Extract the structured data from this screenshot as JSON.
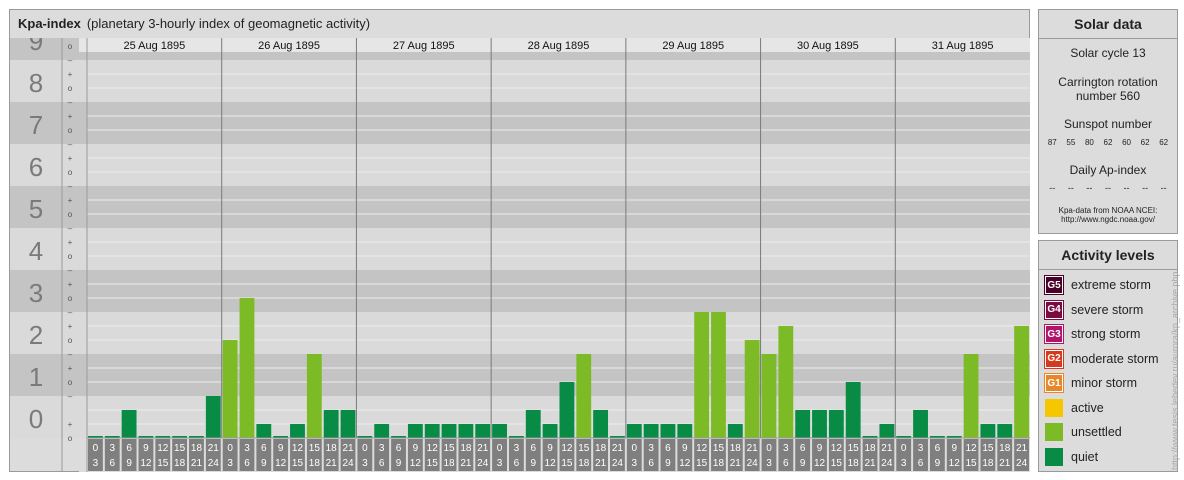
{
  "header": {
    "title": "Kpa-index",
    "subtitle": "(planetary 3-hourly index of geomagnetic activity)"
  },
  "chart_data": {
    "type": "bar",
    "title": "Kpa-index",
    "subtitle": "(planetary 3-hourly index of geomagnetic activity)",
    "y_ticks": [
      "0",
      "1",
      "2",
      "3",
      "4",
      "5",
      "6",
      "7",
      "8",
      "9"
    ],
    "sub_marks": [
      "–",
      "o",
      "+"
    ],
    "ylim": [
      0,
      9
    ],
    "days": [
      "25 Aug 1895",
      "26 Aug 1895",
      "27 Aug 1895",
      "28 Aug 1895",
      "29 Aug 1895",
      "30 Aug 1895",
      "31 Aug 1895"
    ],
    "hour_start": [
      "0",
      "3",
      "6",
      "9",
      "12",
      "15",
      "18",
      "21"
    ],
    "hour_end": [
      "3",
      "6",
      "9",
      "12",
      "15",
      "18",
      "21",
      "24"
    ],
    "values": [
      [
        0,
        0,
        0.667,
        0,
        0,
        0,
        0,
        1
      ],
      [
        2.333,
        3.333,
        0.333,
        0,
        0.333,
        2,
        0.667,
        0.667
      ],
      [
        0,
        0.333,
        0,
        0.333,
        0.333,
        0.333,
        0.333,
        0.333
      ],
      [
        0.333,
        0,
        0.667,
        0.333,
        1.333,
        2,
        0.667,
        0
      ],
      [
        0.333,
        0.333,
        0.333,
        0.333,
        3,
        3,
        0.333,
        2.333
      ],
      [
        2,
        2.667,
        0.667,
        0.667,
        0.667,
        1.333,
        0,
        0.333
      ],
      [
        0,
        0.667,
        0,
        0,
        2,
        0.333,
        0.333,
        2.667
      ]
    ],
    "colors": {
      "quiet": "#078b45",
      "unsettled": "#7dbb26",
      "active": "#f6c600"
    },
    "grid": true
  },
  "solar": {
    "title": "Solar data",
    "cycle": "Solar cycle 13",
    "carrington_line1": "Carrington rotation",
    "carrington_line2": "number 560",
    "sunspot_label": "Sunspot number",
    "sunspot_values": [
      "87",
      "55",
      "80",
      "62",
      "60",
      "62",
      "62"
    ],
    "ap_label": "Daily Ap-index",
    "ap_values": [
      "--",
      "--",
      "--",
      "--",
      "--",
      "--",
      "--"
    ],
    "source_line1": "Kpa-data from NOAA NCEI:",
    "source_line2": "http://www.ngdc.noaa.gov/"
  },
  "activity": {
    "title": "Activity levels",
    "items": [
      {
        "badge": "G5",
        "label": "extreme storm",
        "color": "#4a0028"
      },
      {
        "badge": "G4",
        "label": "severe storm",
        "color": "#7a0a40"
      },
      {
        "badge": "G3",
        "label": "strong storm",
        "color": "#b0156a"
      },
      {
        "badge": "G2",
        "label": "moderate storm",
        "color": "#d63a1e"
      },
      {
        "badge": "G1",
        "label": "minor storm",
        "color": "#e8862a"
      },
      {
        "badge": "",
        "label": "active",
        "color": "#f6c600"
      },
      {
        "badge": "",
        "label": "unsettled",
        "color": "#7dbb26"
      },
      {
        "badge": "",
        "label": "quiet",
        "color": "#078b45"
      }
    ]
  },
  "watermark": "http://www.tesis.lebedev.ru/aurora/kp_archive.php"
}
